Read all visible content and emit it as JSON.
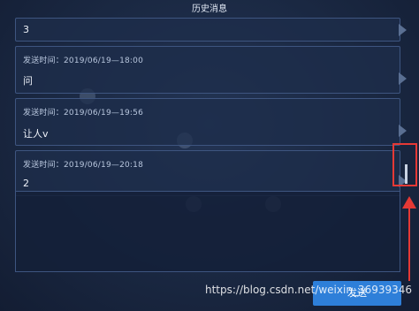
{
  "window": {
    "title": "历史消息"
  },
  "messages": [
    {
      "time": "",
      "text": "3"
    },
    {
      "time": "发送时间：2019/06/19—18:00",
      "text": "问"
    },
    {
      "time": "发送时间：2019/06/19—19:56",
      "text": "让人v"
    },
    {
      "time": "发送时间：2019/06/19—20:18",
      "text": "2"
    }
  ],
  "input": {
    "value": ""
  },
  "send_button": {
    "label": "发送"
  },
  "watermark": "https://blog.csdn.net/weixin_36939346",
  "colors": {
    "background": "#1a2842",
    "border": "#3e5580",
    "accent": "#2e7fd9",
    "annotation": "#e53935"
  }
}
